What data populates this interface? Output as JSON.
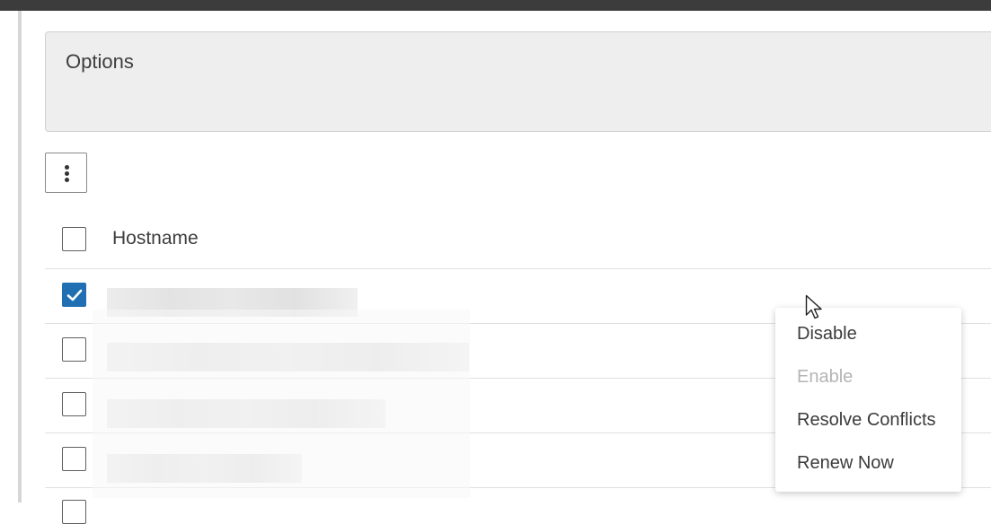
{
  "options_panel": {
    "title": "Options"
  },
  "toolbar": {
    "more_actions_icon": "kebab-vertical-icon"
  },
  "table": {
    "columns": [
      "Hostname"
    ],
    "rows": [
      {
        "hostname": "",
        "checked": true,
        "redacted": true
      },
      {
        "hostname": "",
        "checked": false,
        "redacted": true
      },
      {
        "hostname": "",
        "checked": false,
        "redacted": true
      },
      {
        "hostname": "",
        "checked": false,
        "redacted": true
      }
    ]
  },
  "context_menu": {
    "items": [
      {
        "label": "Disable",
        "enabled": true
      },
      {
        "label": "Enable",
        "enabled": false
      },
      {
        "label": "Resolve Conflicts",
        "enabled": true
      },
      {
        "label": "Renew Now",
        "enabled": true
      }
    ]
  },
  "colors": {
    "accent": "#1f6fb2",
    "topbar": "#3c3c3c"
  }
}
